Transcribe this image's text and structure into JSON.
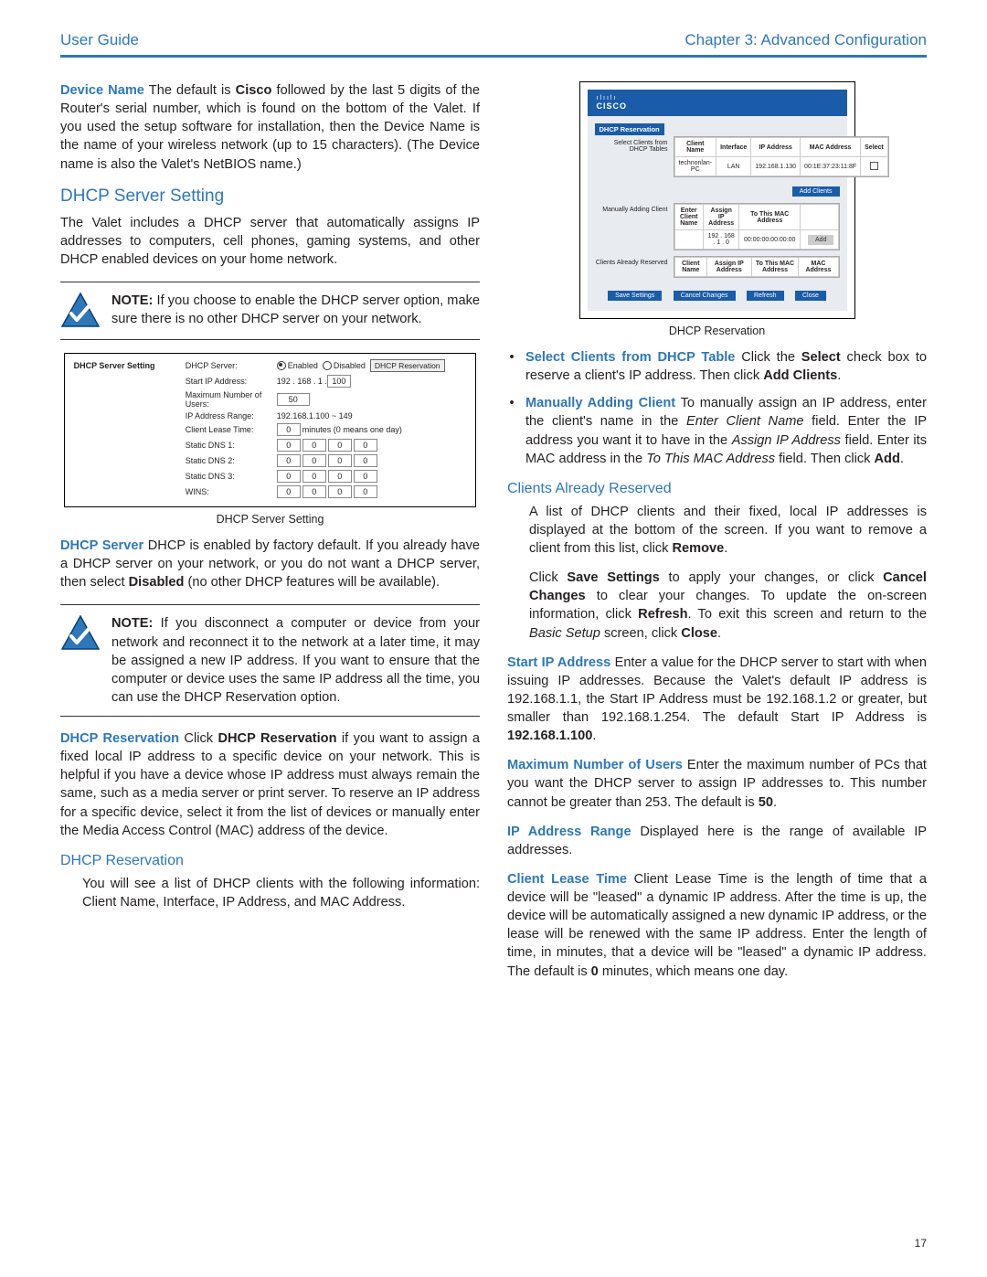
{
  "header": {
    "left": "User Guide",
    "right": "Chapter 3: Advanced Configuration"
  },
  "pageNumber": "17",
  "left": {
    "deviceName": {
      "label": "Device Name",
      "body": "  The default is ",
      "cisco": "Cisco",
      "body2": " followed by the last 5 digits of the Router's serial number, which is found on the bottom of the Valet. If you used the setup software for installation, then the Device Name is the name of your wireless network (up to 15 characters). (The Device name is also the Valet's NetBIOS name.)"
    },
    "dhcp_section": "DHCP Server Setting",
    "dhcp_intro": "The Valet includes a DHCP server that automatically assigns IP addresses to computers, cell phones, gaming systems, and other DHCP enabled devices on your home network.",
    "note1_label": "NOTE:",
    "note1": " If you choose to enable the DHCP server option, make sure there is no other DHCP server on your network.",
    "fig1_caption": "DHCP Server Setting",
    "dhcp_server": {
      "label": "DHCP Server",
      "body": "  DHCP is enabled by factory default. If you already have a DHCP server on your network, or you do not want a DHCP server, then select ",
      "disabled": "Disabled",
      "body2": " (no other DHCP features will be available)."
    },
    "note2_label": "NOTE:",
    "note2": " If you disconnect a computer or device from your network and reconnect it to the network at a later time, it may be assigned a new IP address. If you want to ensure that the computer or device uses the same IP address all the time, you can use the DHCP Reservation option.",
    "dhcp_resv": {
      "label": "DHCP Reservation",
      "body": "  Click ",
      "bold": "DHCP Reservation",
      "body2": " if you want to assign a fixed local IP address to a specific device on your network. This is helpful if you have a device whose IP address must always remain the same, such as a media server or print server. To reserve an IP address for a specific device, select it from the list of devices or manually enter the Media Access Control (MAC) address of the device."
    },
    "sub_head": "DHCP Reservation",
    "sub_body": "You will see a list of DHCP clients with the following information: Client Name, Interface, IP Address, and MAC Address.",
    "fig1": {
      "title": "DHCP Server Setting",
      "rows": {
        "server": "DHCP Server:",
        "enabled": "Enabled",
        "disabled": "Disabled",
        "resv_btn": "DHCP Reservation",
        "start": "Start IP Address:",
        "start_val": "192 . 168 . 1 .",
        "start_last": "100",
        "maxu": "Maximum Number of Users:",
        "maxu_val": "50",
        "range": "IP Address Range:",
        "range_val": "192.168.1.100 ~ 149",
        "lease": "Client Lease Time:",
        "lease_val": "0",
        "lease_suffix": "minutes (0 means one day)",
        "dns1": "Static DNS 1:",
        "dns2": "Static DNS 2:",
        "dns3": "Static DNS 3:",
        "wins": "WINS:",
        "zero": "0"
      }
    }
  },
  "right": {
    "fig2_caption": "DHCP Reservation",
    "fig2": {
      "brand_top": "ılıılı",
      "brand": "CISCO",
      "sec1_lbl": "DHCP Reservation",
      "sec1_sub": "Select Clients from DHCP Tables",
      "th_client": "Client Name",
      "th_if": "Interface",
      "th_ip": "IP Address",
      "th_mac": "MAC Address",
      "th_sel": "Select",
      "row1_name": "technonlan-PC",
      "row1_if": "LAN",
      "row1_ip": "192.168.1.130",
      "row1_mac": "00:1E:37:23:11:8F",
      "add_clients": "Add Clients",
      "sec2_sub": "Manually Adding Client",
      "th2_enter": "Enter Client Name",
      "th2_assign": "Assign IP Address",
      "th2_mac": "To This MAC Address",
      "row2_ip": "192 . 168 . 1 . 0",
      "row2_mac": "00:00:00:00:00:00",
      "add": "Add",
      "sec3_sub": "Clients Already Reserved",
      "th3_client": "Client Name",
      "th3_assign": "Assign IP Address",
      "th3_mac": "To This MAC Address",
      "th3_macshort": "MAC Address",
      "btn_save": "Save Settings",
      "btn_cancel": "Cancel Changes",
      "btn_refresh": "Refresh",
      "btn_close": "Close"
    },
    "bullet1": {
      "label": "Select Clients from DHCP Table",
      "body": "  Click the ",
      "select": "Select",
      "body2": " check box to reserve a client's IP address. Then click ",
      "add": "Add Clients",
      "body3": "."
    },
    "bullet2": {
      "label": "Manually Adding Client",
      "body": "  To manually assign an IP address, enter the client's name in the ",
      "i1": "Enter Client Name",
      "body2": " field. Enter the IP address you want it to have in the ",
      "i2": "Assign IP Address",
      "body3": " field. Enter its MAC address in the ",
      "i3": "To This MAC Address",
      "body4": " field. Then click ",
      "add": "Add",
      "body5": "."
    },
    "already_head": "Clients Already Reserved",
    "already1_a": "A list of DHCP clients and their fixed, local IP addresses is displayed at the bottom of the screen. If you want to remove a client from this list, click ",
    "already1_b": "Remove",
    "already1_c": ".",
    "already2_a": "Click ",
    "already2_b": "Save Settings",
    "already2_c": " to apply your changes, or click ",
    "already2_d": "Cancel Changes",
    "already2_e": " to clear your changes. To update the on-screen information, click ",
    "already2_f": "Refresh",
    "already2_g": ". To exit this screen and return to the ",
    "already2_h": "Basic Setup",
    "already2_i": " screen, click ",
    "already2_j": "Close",
    "already2_k": ".",
    "startip": {
      "label": "Start IP Address",
      "body": "  Enter a value for the DHCP server to start with when issuing IP addresses. Because the Valet's default IP address is 192.168.1.1, the Start IP Address must be 192.168.1.2 or greater, but smaller than 192.168.1.254. The default Start IP Address is ",
      "b": "192.168.1.100",
      "body2": "."
    },
    "maxusers": {
      "label": "Maximum Number of Users",
      "body": "  Enter the maximum number of PCs that you want the DHCP server to assign IP addresses to. This number cannot be greater than 253. The default is ",
      "b": "50",
      "body2": "."
    },
    "iprange": {
      "label": "IP Address Range",
      "body": "  Displayed here is the range of available IP addresses."
    },
    "lease": {
      "label": "Client Lease Time",
      "body": "  Client Lease Time is the length of time that a device will be \"leased\" a dynamic IP address. After the time is up, the device will be automatically assigned a new dynamic IP address, or the lease will be renewed with the same IP address. Enter the length of time, in minutes, that a device will be \"leased\" a dynamic IP address. The default is ",
      "b": "0",
      "body2": " minutes, which means one day."
    }
  }
}
